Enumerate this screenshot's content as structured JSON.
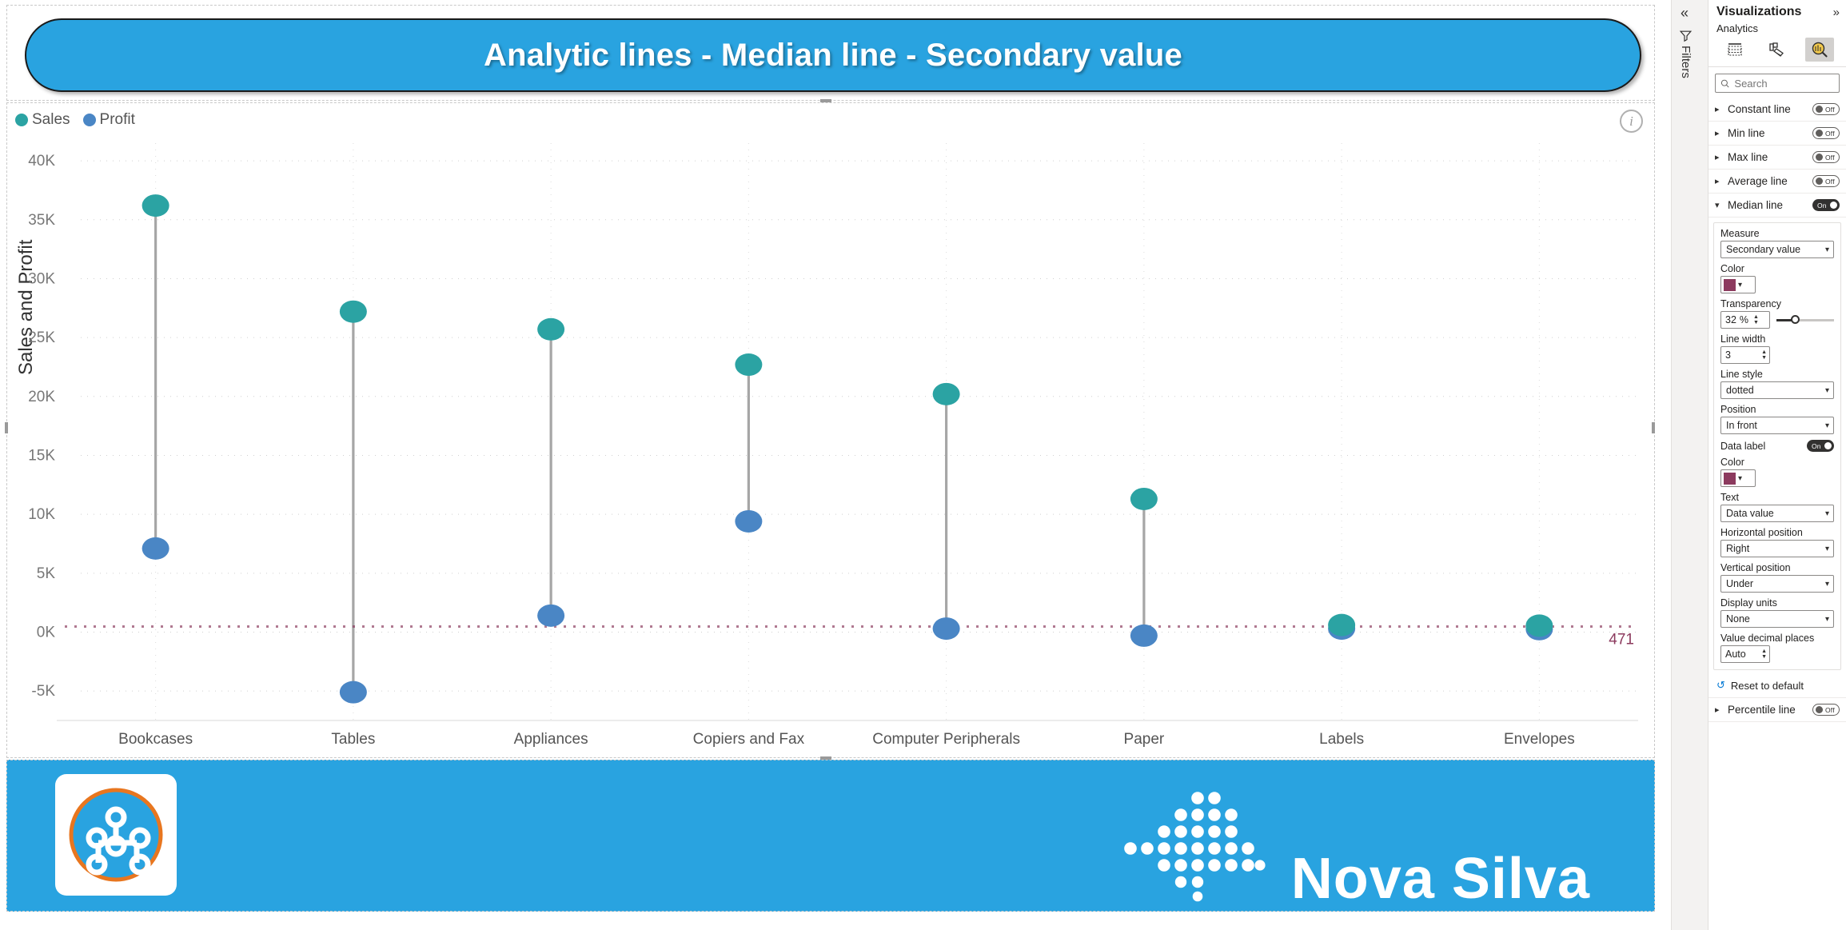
{
  "report": {
    "title": "Analytic lines - Median line - Secondary value",
    "title_bg": "#29a3e0",
    "footer_bg": "#29a3e0",
    "brand_name": "Nova Silva"
  },
  "chart_data": {
    "type": "scatter",
    "subtype": "dumbbell",
    "title": "Analytic lines - Median line - Secondary value",
    "xlabel": "",
    "ylabel": "Sales and Profit",
    "ylim": [
      -7500,
      41500
    ],
    "yticks": [
      "40K",
      "35K",
      "30K",
      "25K",
      "20K",
      "15K",
      "10K",
      "5K",
      "0K",
      "-5K"
    ],
    "ytick_values": [
      40000,
      35000,
      30000,
      25000,
      20000,
      15000,
      10000,
      5000,
      0,
      -5000
    ],
    "grid": true,
    "legend_position": "top-left",
    "categories": [
      "Bookcases",
      "Tables",
      "Appliances",
      "Copiers and Fax",
      "Computer Peripherals",
      "Paper",
      "Labels",
      "Envelopes"
    ],
    "series": [
      {
        "name": "Sales",
        "color": "#2ba3a3",
        "values": [
          36200,
          27200,
          25700,
          22700,
          20200,
          11300,
          600,
          550
        ]
      },
      {
        "name": "Profit",
        "color": "#4a86c5",
        "values": [
          7100,
          -5100,
          1400,
          9400,
          300,
          -300,
          300,
          250
        ]
      }
    ],
    "annotations": [
      {
        "name": "median-line",
        "label": "471",
        "value": 471,
        "color": "#8c3a5e",
        "style": "dotted",
        "width": 3
      }
    ]
  },
  "pane": {
    "title": "Visualizations",
    "expand_icon": "chevron-double-right-icon",
    "section_label": "Analytics",
    "tabs": [
      {
        "name": "fields-tab",
        "icon": "table-fields-icon",
        "active": false
      },
      {
        "name": "format-tab",
        "icon": "paint-roller-icon",
        "active": false
      },
      {
        "name": "analytics-tab",
        "icon": "magnifier-chart-icon",
        "active": true
      }
    ],
    "search": {
      "placeholder": "Search",
      "value": "",
      "icon": "search-icon"
    },
    "sections": [
      {
        "label": "Constant line",
        "state": "Off",
        "on": false,
        "expanded": false
      },
      {
        "label": "Min line",
        "state": "Off",
        "on": false,
        "expanded": false
      },
      {
        "label": "Max line",
        "state": "Off",
        "on": false,
        "expanded": false
      },
      {
        "label": "Average line",
        "state": "Off",
        "on": false,
        "expanded": false
      },
      {
        "label": "Median line",
        "state": "On",
        "on": true,
        "expanded": true
      },
      {
        "label": "Percentile line",
        "state": "Off",
        "on": false,
        "expanded": false
      }
    ],
    "median": {
      "measure_label": "Measure",
      "measure_value": "Secondary value",
      "color_label": "Color",
      "color_value": "#8c3a5e",
      "transparency_label": "Transparency",
      "transparency_value": "32",
      "transparency_unit": "%",
      "line_width_label": "Line width",
      "line_width_value": "3",
      "line_style_label": "Line style",
      "line_style_value": "dotted",
      "position_label": "Position",
      "position_value": "In front",
      "data_label_label": "Data label",
      "data_label_state": "On",
      "label_color_label": "Color",
      "label_color_value": "#8c3a5e",
      "text_label": "Text",
      "text_value": "Data value",
      "hpos_label": "Horizontal position",
      "hpos_value": "Right",
      "vpos_label": "Vertical position",
      "vpos_value": "Under",
      "display_units_label": "Display units",
      "display_units_value": "None",
      "decimals_label": "Value decimal places",
      "decimals_value": "Auto"
    },
    "reset_label": "Reset to default"
  },
  "rail": {
    "collapse_icon": "chevron-double-left-icon",
    "filters_label": "Filters",
    "filters_icon": "filter-icon"
  }
}
